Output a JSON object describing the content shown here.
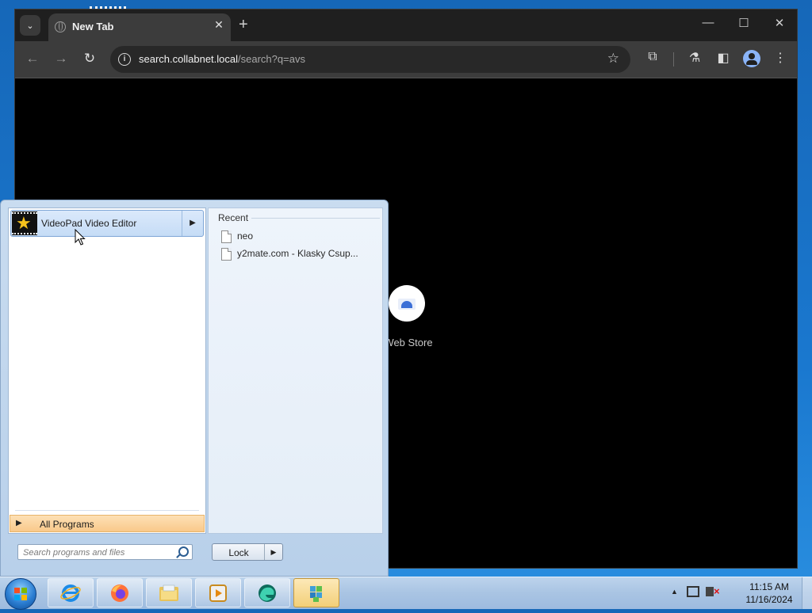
{
  "browser": {
    "tab_title": "New Tab",
    "url_host": "search.collabnet.local",
    "url_path": "/search?q=avs",
    "shortcut_label": "Web Store"
  },
  "start_menu": {
    "pinned_program": "VideoPad Video Editor",
    "recent_header": "Recent",
    "recent_items": [
      "neo",
      "y2mate.com - Klasky Csup..."
    ],
    "all_programs": "All Programs",
    "search_placeholder": "Search programs and files",
    "lock_label": "Lock"
  },
  "taskbar": {
    "apps": [
      "internet-explorer",
      "firefox",
      "file-explorer",
      "media-player",
      "edge-dev",
      "app-cube"
    ],
    "clock_time": "11:15 AM",
    "clock_date": "11/16/2024"
  },
  "colors": {
    "taskbar_active": "#f2cf78",
    "all_programs_bg": "#f9c98b",
    "desktop": "#1a78cf"
  }
}
